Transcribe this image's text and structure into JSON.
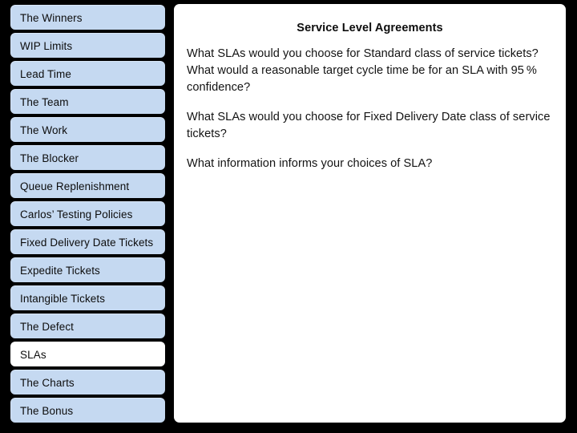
{
  "sidebar": {
    "items": [
      {
        "label": "The Winners",
        "active": false
      },
      {
        "label": "WIP Limits",
        "active": false
      },
      {
        "label": "Lead Time",
        "active": false
      },
      {
        "label": "The Team",
        "active": false
      },
      {
        "label": "The Work",
        "active": false
      },
      {
        "label": "The Blocker",
        "active": false
      },
      {
        "label": "Queue Replenishment",
        "active": false
      },
      {
        "label": "Carlos’ Testing Policies",
        "active": false
      },
      {
        "label": "Fixed Delivery Date Tickets",
        "active": false
      },
      {
        "label": "Expedite Tickets",
        "active": false
      },
      {
        "label": "Intangible Tickets",
        "active": false
      },
      {
        "label": "The Defect",
        "active": false
      },
      {
        "label": "SLAs",
        "active": true
      },
      {
        "label": "The Charts",
        "active": false
      },
      {
        "label": "The Bonus",
        "active": false
      }
    ],
    "item_bg_color": "#c5d9f1",
    "item_active_bg_color": "#ffffff"
  },
  "main": {
    "title": "Service Level Agreements",
    "paragraphs": [
      "What SLAs would you choose for Standard class of service tickets? What would a reasonable target cycle time be for an SLA with 95 % confidence?",
      "What SLAs would you choose for Fixed Delivery Date class of service tickets?",
      "What information informs your choices of SLA?"
    ],
    "panel_bg_color": "#ffffff"
  },
  "background_color": "#000000"
}
